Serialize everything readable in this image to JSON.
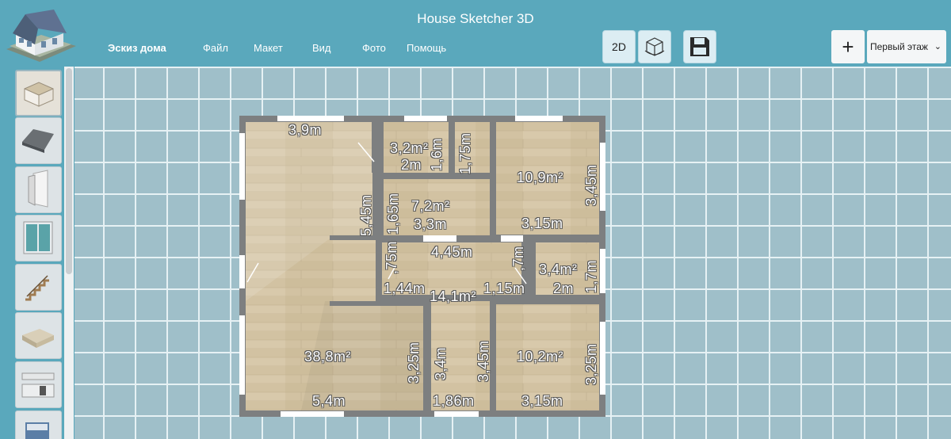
{
  "app": {
    "title": "House Sketcher 3D"
  },
  "menu": {
    "items": [
      {
        "label": "Эскиз дома",
        "active": true
      },
      {
        "label": "Файл"
      },
      {
        "label": "Макет"
      },
      {
        "label": "Вид"
      },
      {
        "label": "Фото"
      },
      {
        "label": "Помощь"
      }
    ]
  },
  "toolbar": {
    "view_2d_label": "2D",
    "view_3d_icon": "cube-3d-icon",
    "save_icon": "floppy-disk-icon",
    "add_icon": "plus-icon",
    "floor_select_value": "Первый этаж"
  },
  "sidebar": {
    "tools": [
      {
        "icon": "room-box-icon",
        "selected": true
      },
      {
        "icon": "roof-icon"
      },
      {
        "icon": "door-icon"
      },
      {
        "icon": "window-icon"
      },
      {
        "icon": "stairs-icon"
      },
      {
        "icon": "sofa-icon"
      },
      {
        "icon": "kitchen-icon"
      },
      {
        "icon": "bed-icon"
      }
    ]
  },
  "plan": {
    "labels": {
      "top_left_width": "3,9m",
      "bath_area": "3,2m²",
      "bath_width": "2m",
      "bath_height": "1,6m",
      "stair_height": "1,75m",
      "bedroom_tr_area": "10,9m²",
      "bedroom_tr_height": "3,45m",
      "bedroom_tr_width": "3,15m",
      "living_wall_height": "5,45m",
      "hall_height": "1,65m",
      "hall_area": "7,2m²",
      "hall_width": "3,3m",
      "corridor_width": "4,45m",
      "corridor_area": "14,1m²",
      "corridor_left": "1,44m",
      "corridor_left_h": ",75m",
      "corridor_mid": "1,15m",
      "corridor_mid_h": ",7m",
      "small_area": "3,4m²",
      "small_width": "2m",
      "small_height": "1,7m",
      "living_area": "38,8m²",
      "living_width": "5,4m",
      "living_height": "3,25m",
      "passage_height": "3,4m",
      "passage_height2": "3,45m",
      "passage_width": "1,86m",
      "bedroom_br_area": "10,2m²",
      "bedroom_br_height": "3,25m",
      "bedroom_br_width": "3,15m"
    }
  },
  "colors": {
    "background": "#5aa8bc",
    "grid": "#9fbfc9",
    "floor": "#d4c3a4",
    "wall": "#7d7f80"
  }
}
